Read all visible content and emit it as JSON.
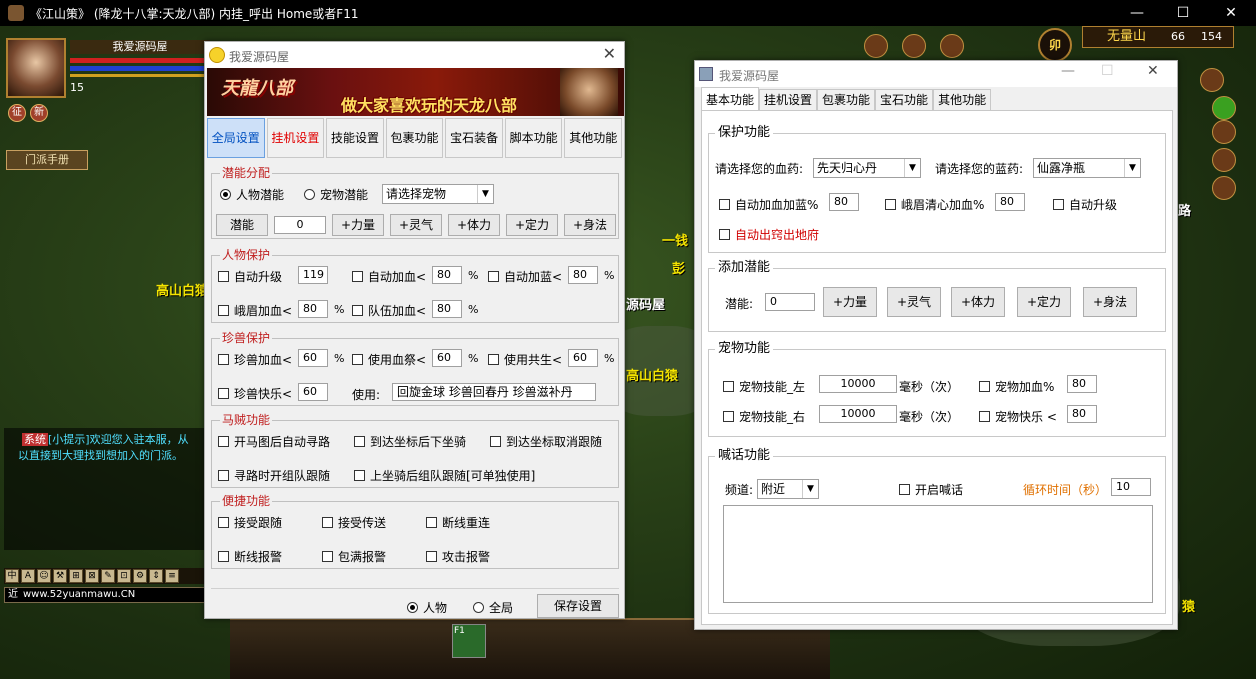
{
  "game": {
    "title": "《江山策》   (降龙十八掌:天龙八部)   内挂_呼出 Home或者F11",
    "window_controls": {
      "minimize": "—",
      "maximize": "☐",
      "close": "✕"
    },
    "player": {
      "name": "我爱源码屋",
      "level": "15",
      "btn_sign": "征",
      "btn_new": "新",
      "sect_manual": "门派手册"
    },
    "map": {
      "name": "无量山",
      "x": "66",
      "y": "154",
      "lock_label": "卯"
    },
    "npc_labels": [
      "高山白猿",
      "一钱",
      "彭",
      "源码屋",
      "高山白猿",
      "猿",
      "路"
    ],
    "chat": {
      "tag": "系统",
      "line1": "[小提示]欢迎您入驻本服，从",
      "line2": "以直接到大理找到想加入的门派。",
      "input": "www.52yuanmawu.CN",
      "input_prefix": "近"
    },
    "chat_tools": [
      "中",
      "A",
      "☺",
      "⚒",
      "⊞",
      "⊠",
      "✎",
      "⊡",
      "⚙",
      "⇕",
      "≡"
    ],
    "skill_key": "F1"
  },
  "win1": {
    "title": "我爱源码屋",
    "close": "✕",
    "banner": {
      "logo": "天龍八部",
      "slogan": "做大家喜欢玩的天龙八部"
    },
    "tabs": [
      "全局设置",
      "挂机设置",
      "技能设置",
      "包裹功能",
      "宝石装备",
      "脚本功能",
      "其他功能"
    ],
    "potential": {
      "legend": "潜能分配",
      "radio_char": "人物潜能",
      "radio_pet": "宠物潜能",
      "pet_select": "请选择宠物",
      "btn_potential": "潜能",
      "value": "0",
      "btns": [
        "+力量",
        "+灵气",
        "+体力",
        "+定力",
        "+身法"
      ]
    },
    "char_protect": {
      "legend": "人物保护",
      "auto_level": "自动升级",
      "auto_level_val": "119",
      "auto_hp": "自动加血<",
      "auto_hp_val": "80",
      "auto_mp": "自动加蓝<",
      "auto_mp_val": "80",
      "emei_hp": "峨眉加血<",
      "emei_hp_val": "80",
      "team_hp": "队伍加血<",
      "team_hp_val": "80",
      "unit": "%"
    },
    "pet_protect": {
      "legend": "珍兽保护",
      "pet_hp": "珍兽加血<",
      "pet_hp_val": "60",
      "use_blood": "使用血祭<",
      "use_blood_val": "60",
      "use_share": "使用共生<",
      "use_share_val": "60",
      "pet_happy": "珍兽快乐<",
      "pet_happy_val": "60",
      "use_label": "使用:",
      "use_items": "回旋金球 珍兽回春丹 珍兽滋补丹",
      "unit": "%"
    },
    "horse": {
      "legend": "马贼功能",
      "opt1": "开马图后自动寻路",
      "opt2": "到达坐标后下坐骑",
      "opt3": "到达坐标取消跟随",
      "opt4": "寻路时开组队跟随",
      "opt5": "上坐骑后组队跟随[可单独使用]"
    },
    "convenient": {
      "legend": "便捷功能",
      "opt1": "接受跟随",
      "opt2": "接受传送",
      "opt3": "断线重连",
      "opt4": "断线报警",
      "opt5": "包满报警",
      "opt6": "攻击报警"
    },
    "footer": {
      "radio_char": "人物",
      "radio_global": "全局",
      "save": "保存设置"
    }
  },
  "win2": {
    "title": "我爱源码屋",
    "controls": {
      "minimize": "—",
      "maximize": "☐",
      "close": "✕"
    },
    "tabs": [
      "基本功能",
      "挂机设置",
      "包裹功能",
      "宝石功能",
      "其他功能"
    ],
    "protect": {
      "legend": "保护功能",
      "hp_label": "请选择您的血药:",
      "hp_value": "先天归心丹",
      "mp_label": "请选择您的蓝药:",
      "mp_value": "仙露净瓶",
      "auto_hp_mp": "自动加血加蓝%",
      "auto_hp_mp_val": "80",
      "emei": "峨眉清心加血%",
      "emei_val": "80",
      "auto_level": "自动升级",
      "auto_escape": "自动出窍出地府"
    },
    "add_potential": {
      "legend": "添加潜能",
      "label": "潜能:",
      "value": "0",
      "btns": [
        "+力量",
        "+灵气",
        "+体力",
        "+定力",
        "+身法"
      ]
    },
    "pet": {
      "legend": "宠物功能",
      "skill_left": "宠物技能_左",
      "skill_left_val": "10000",
      "unit": "毫秒（次）",
      "skill_right": "宠物技能_右",
      "skill_right_val": "10000",
      "pet_hp": "宠物加血%",
      "pet_hp_val": "80",
      "pet_happy": "宠物快乐 <",
      "pet_happy_val": "80"
    },
    "shout": {
      "legend": "喊话功能",
      "channel_label": "频道:",
      "channel_value": "附近",
      "enable": "开启喊话",
      "cycle_label": "循环时间（秒）",
      "cycle_value": "10",
      "message": ""
    }
  }
}
